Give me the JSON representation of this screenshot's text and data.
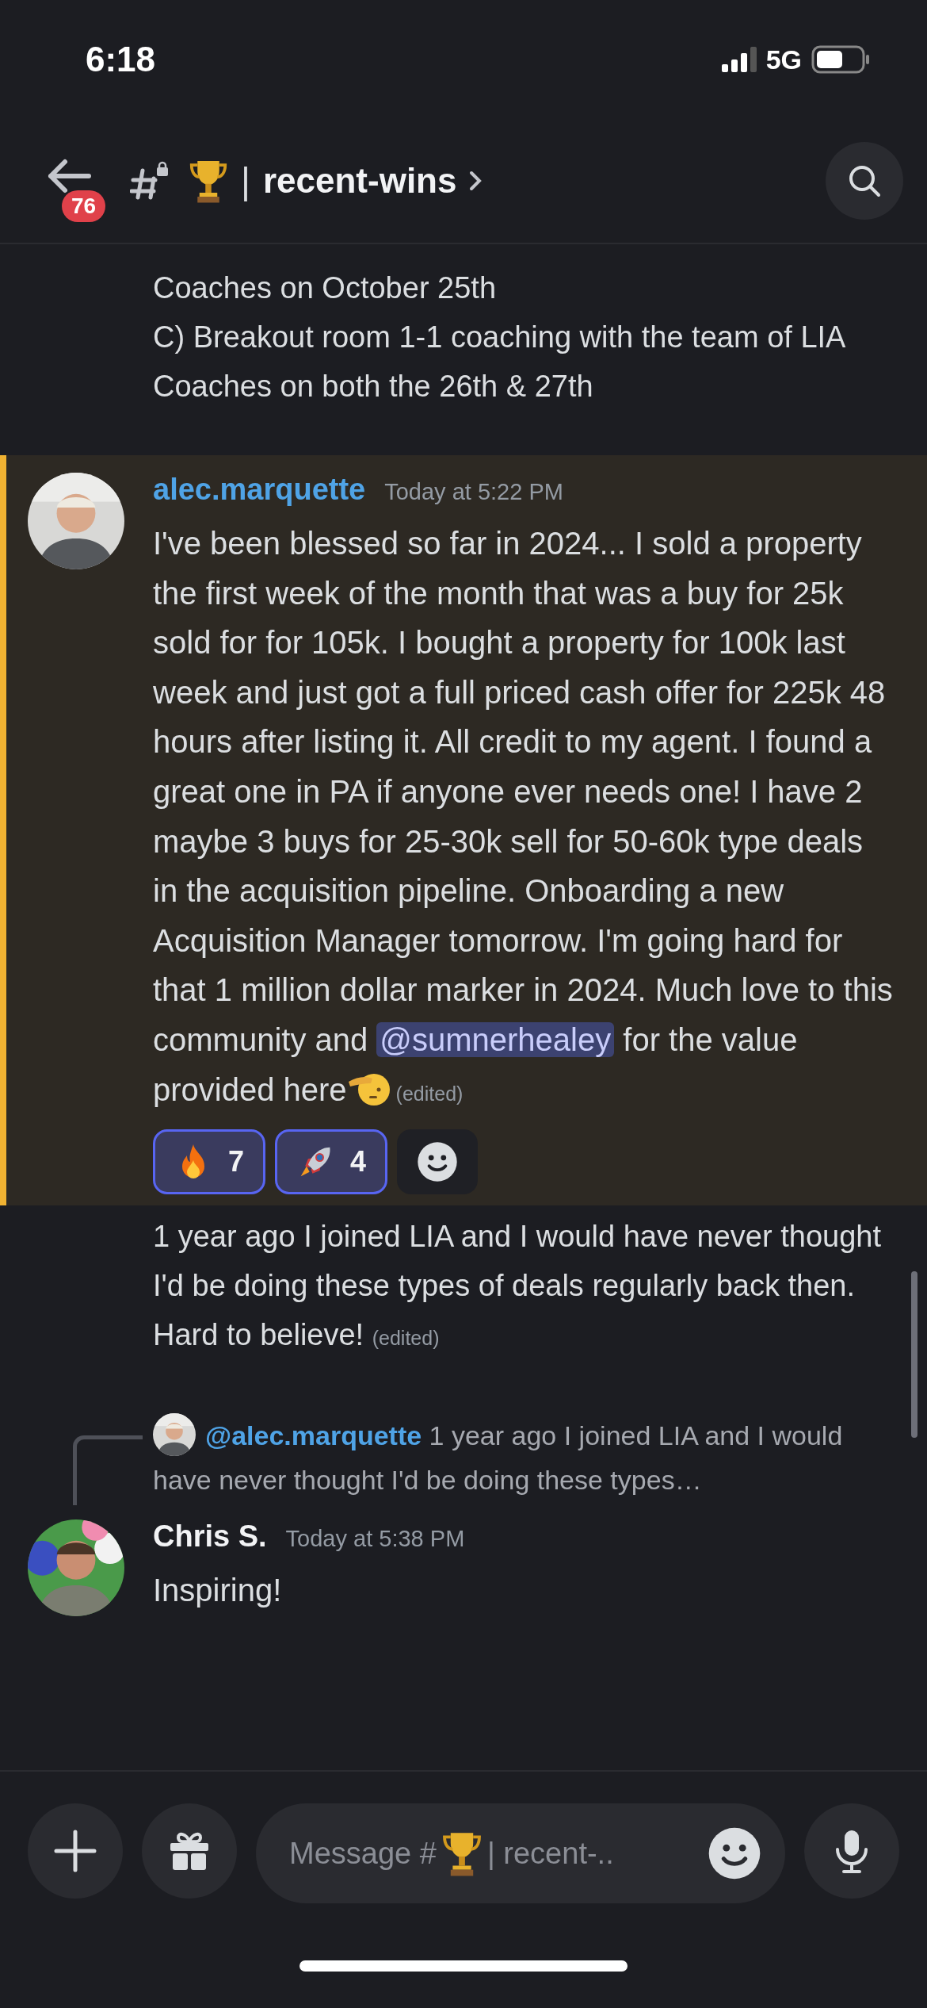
{
  "status_bar": {
    "time": "6:18",
    "network": "5G"
  },
  "header": {
    "badge": "76",
    "separator": "|",
    "channel": "recent-wins"
  },
  "messages": [
    {
      "kind": "continuation",
      "paragraphs": [
        "Coaches on October 25th",
        "C) Breakout room 1-1 coaching with the team of LIA Coaches on both the 26th & 27th"
      ]
    },
    {
      "kind": "message",
      "highlighted": true,
      "author": "alec.marquette",
      "color": "#4fa3e6",
      "timestamp": "Today at 5:22 PM",
      "body": [
        {
          "kind": "text",
          "text": "I've been blessed so far in 2024... I sold a property the first week of the month that was a buy for 25k sold for for 105k. I bought a property for 100k last week and just got a full priced cash offer for 225k 48 hours after listing it. All credit to my agent. I found a great one in PA if anyone ever needs one! I have 2 maybe 3 buys for 25-30k sell for 50-60k type deals in the acquisition pipeline. Onboarding a new Acquisition Manager tomorrow. I'm going hard  for that 1 million dollar marker in 2024. Much love to this community and "
        },
        {
          "kind": "mention",
          "text": "@sumnerhealey"
        },
        {
          "kind": "text",
          "text": " for the value provided here"
        },
        {
          "kind": "salute"
        }
      ],
      "edited": "(edited)",
      "reactions": [
        {
          "kind": "fire",
          "count": "7",
          "selected": true
        },
        {
          "kind": "rocket",
          "count": "4",
          "selected": true
        }
      ]
    },
    {
      "kind": "continuation",
      "paragraphs": [
        "1 year ago I joined LIA and I would have never thought I'd be doing these types of deals regularly back then. Hard to believe!"
      ],
      "edited": "(edited)"
    },
    {
      "kind": "message",
      "highlighted": false,
      "reply_to": {
        "author": "@alec.marquette",
        "preview": "1 year ago I joined LIA and I would have never thought I'd be doing these types…"
      },
      "author": "Chris S.",
      "color": "#f2f3f5",
      "timestamp": "Today at 5:38 PM",
      "body": [
        {
          "kind": "text",
          "text": "Inspiring!"
        }
      ]
    }
  ],
  "composer": {
    "placeholder": "Message #",
    "channel_hint": "| recent-.."
  }
}
